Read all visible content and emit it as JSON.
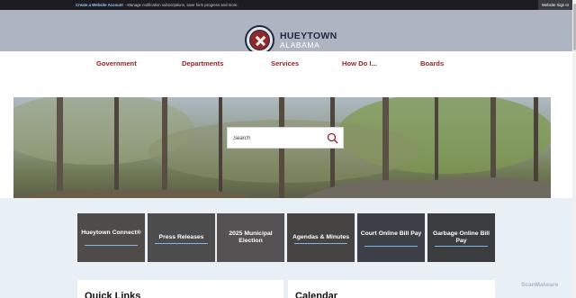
{
  "topbar": {
    "create_account": "Create a Website Account",
    "message": " - Manage notification subscriptions, save form progress and more.",
    "signin": "Website Sign In"
  },
  "brand": {
    "name": "HUEYTOWN",
    "sub": "ALABAMA"
  },
  "nav": {
    "items": [
      {
        "label": "Government"
      },
      {
        "label": "Departments"
      },
      {
        "label": "Services"
      },
      {
        "label": "How Do I..."
      },
      {
        "label": "Boards"
      }
    ]
  },
  "search": {
    "placeholder": "Search",
    "icon": "search-icon"
  },
  "tiles": [
    {
      "label": "Hueytown Connect®",
      "bg": "#4e4b49"
    },
    {
      "label": "Press Releases",
      "bg": "#4d4c4d"
    },
    {
      "label": "2025 Municipal Election",
      "bg": "#545252"
    },
    {
      "label": "Agendas & Minutes",
      "bg": "#464443"
    },
    {
      "label": "Court Online Bill Pay",
      "bg": "#3d4046"
    },
    {
      "label": "Garbage Online Bill Pay",
      "bg": "#3b3c3e"
    }
  ],
  "sections": {
    "quick_links": "Quick Links",
    "calendar": "Calendar"
  },
  "watermark": "ScanMalware",
  "colors": {
    "accent_red": "#9a1f24",
    "header_bg": "#aeb5c1",
    "topbar_bg": "#1c1c22",
    "tile_underline": "#7fb4ea"
  }
}
